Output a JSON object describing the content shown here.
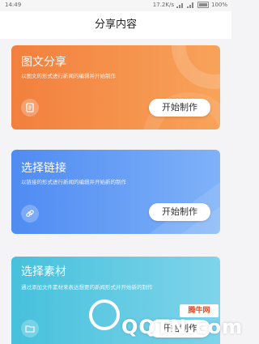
{
  "status_bar": {
    "time": "14:49",
    "network": "17.2K/s",
    "battery": "100%"
  },
  "header": {
    "title": "分享内容"
  },
  "cards": [
    {
      "title": "图文分享",
      "subtitle": "以图文的形式进行新闻的编辑并开始制作",
      "button": "开始制作",
      "icon": "document-icon",
      "color": "#f27f3d"
    },
    {
      "title": "选择链接",
      "subtitle": "以链接的形式进行新闻的编辑并开始新的制作",
      "button": "开始制作",
      "icon": "link-icon",
      "color": "#4f8bf2"
    },
    {
      "title": "选择素材",
      "subtitle": "通过添加文件素材来表达想要的新闻形式并开始新的制作",
      "button": "开始制作",
      "icon": "folder-icon",
      "color": "#46c1dc"
    }
  ],
  "watermark": {
    "text": "QQTN.com",
    "badge": "腾牛网"
  }
}
